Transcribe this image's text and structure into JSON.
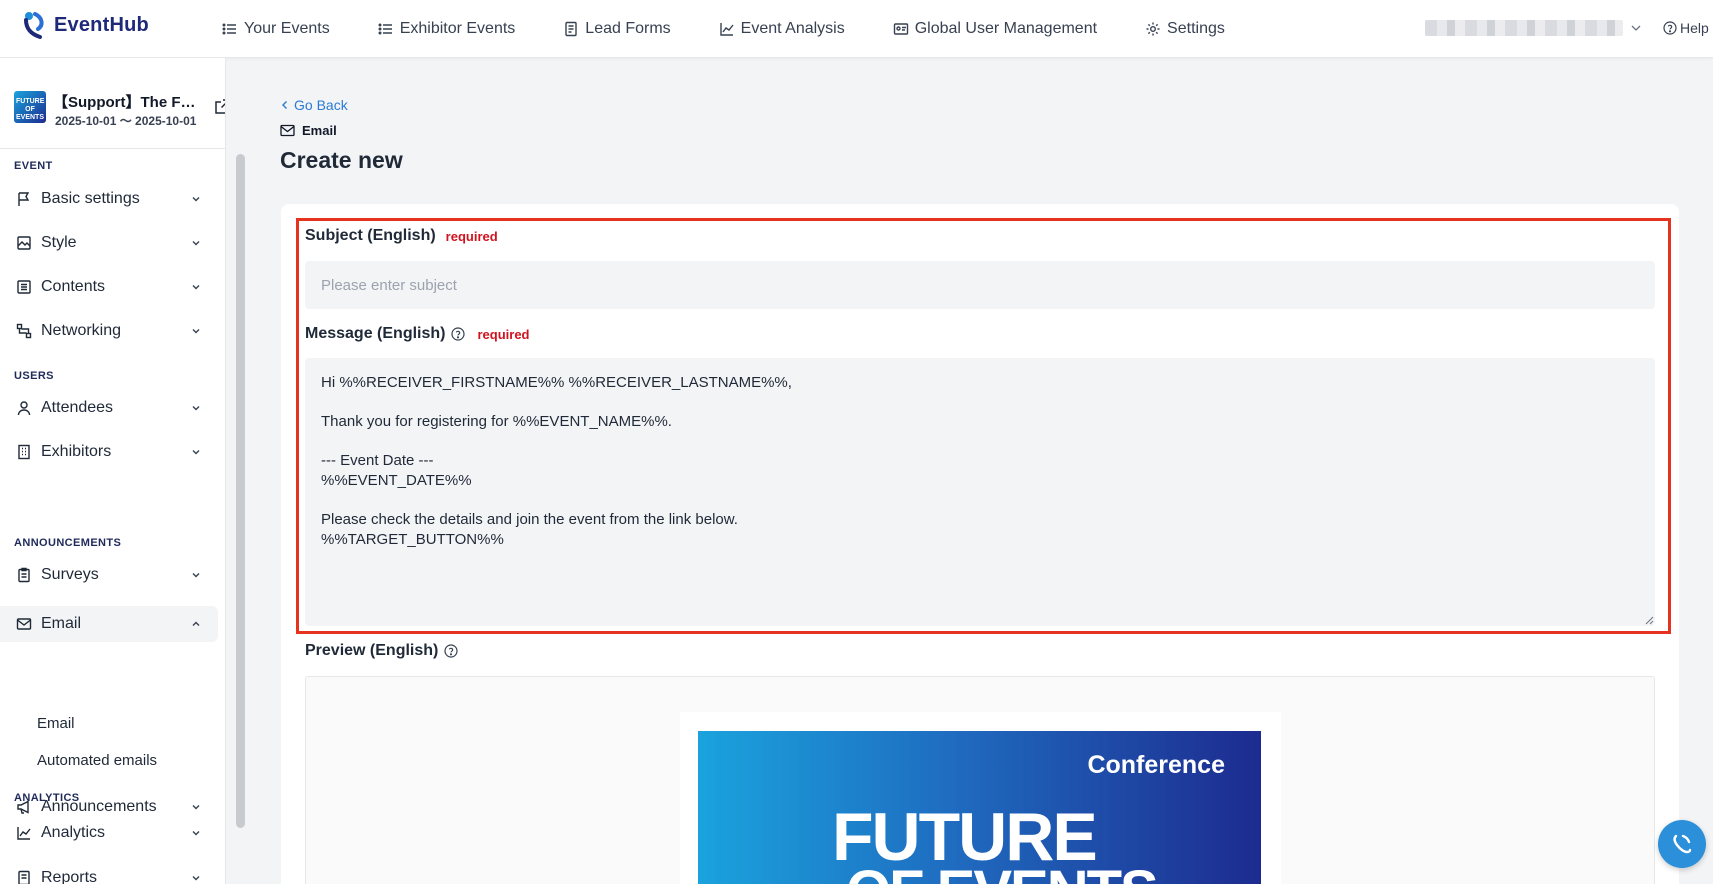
{
  "app": {
    "logo_text": "EventHub"
  },
  "nav": {
    "items": [
      {
        "label": "Your Events",
        "icon": "list-icon"
      },
      {
        "label": "Exhibitor Events",
        "icon": "list-icon"
      },
      {
        "label": "Lead Forms",
        "icon": "form-icon"
      },
      {
        "label": "Event Analysis",
        "icon": "chart-icon"
      },
      {
        "label": "Global User Management",
        "icon": "id-card-icon"
      },
      {
        "label": "Settings",
        "icon": "gear-icon"
      }
    ],
    "help_label": "Help"
  },
  "sidebar": {
    "event_name": "【Support】The F…",
    "event_dates": "2025-10-01 ～ 2025-10-01",
    "event_thumb_text": "FUTURE OF EVENTS",
    "sections": {
      "event": "EVENT",
      "users": "USERS",
      "announcements": "ANNOUNCEMENTS",
      "analytics": "ANALYTICS"
    },
    "items": {
      "basic_settings": "Basic settings",
      "style": "Style",
      "contents": "Contents",
      "networking": "Networking",
      "attendees": "Attendees",
      "exhibitors": "Exhibitors",
      "surveys": "Surveys",
      "email": "Email",
      "email_sub": "Email",
      "automated_emails": "Automated emails",
      "announcements": "Announcements",
      "analytics": "Analytics",
      "reports": "Reports"
    }
  },
  "main": {
    "back_label": "Go Back",
    "breadcrumb": "Email",
    "title": "Create new",
    "subject": {
      "label": "Subject (English)",
      "required": "required",
      "placeholder": "Please enter subject",
      "value": ""
    },
    "message": {
      "label": "Message (English)",
      "required": "required",
      "value": "Hi %%RECEIVER_FIRSTNAME%% %%RECEIVER_LASTNAME%%,\n\nThank you for registering for %%EVENT_NAME%%.\n\n--- Event Date ---\n%%EVENT_DATE%%\n\nPlease check the details and join the event from the link below.\n%%TARGET_BUTTON%%"
    },
    "preview": {
      "label": "Preview (English)",
      "banner_tag": "Conference",
      "banner_line1": "FUTURE",
      "banner_line2": "OF EVENTS"
    }
  },
  "colors": {
    "accent": "#2b7bd3",
    "brand": "#1e2a78",
    "required": "#d0141f",
    "highlight": "#e63320"
  }
}
